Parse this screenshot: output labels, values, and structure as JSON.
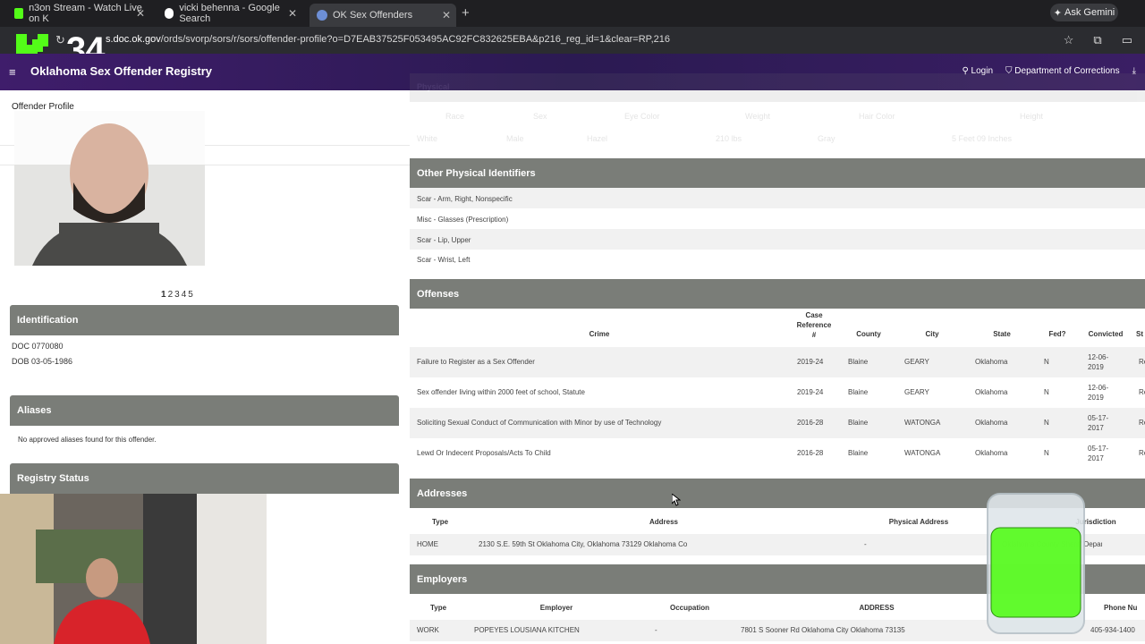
{
  "browser": {
    "tabs": [
      {
        "title": "n3on Stream - Watch Live on K",
        "active": false
      },
      {
        "title": "vicki behenna - Google Search",
        "active": false
      },
      {
        "title": "OK Sex Offenders",
        "active": true
      }
    ],
    "ask_gemini": "Ask Gemini",
    "url_domain": "s.doc.ok.gov",
    "url_path": "/ords/svorp/sors/r/sors/offender-profile?o=D7EAB37525F053495AC92FC832625EBA&p216_reg_id=1&clear=RP,216",
    "overlay_number": "34"
  },
  "site": {
    "title": "Oklahoma Sex Offender Registry",
    "login": "Login",
    "doc_link": "Department of Corrections"
  },
  "left": {
    "breadcrumb": "Offender Profile",
    "pages": [
      "1",
      "2",
      "3",
      "4",
      "5"
    ],
    "identification": {
      "heading": "Identification",
      "doc": "DOC 0770080",
      "dob": "DOB 03-05-1986"
    },
    "aliases": {
      "heading": "Aliases",
      "note": "No approved aliases found for this offender."
    },
    "registry_status": {
      "heading": "Registry Status"
    }
  },
  "right": {
    "faded": {
      "heading": "Physical",
      "cols": [
        "Race",
        "Sex",
        "Eye Color",
        "Weight",
        "Hair Color",
        "Height"
      ],
      "vals": [
        "White",
        "Male",
        "Hazel",
        "210 lbs",
        "Gray",
        "5 Feet 09 Inches"
      ]
    },
    "physical_ids": {
      "heading": "Other Physical Identifiers",
      "items": [
        "Scar - Arm, Right, Nonspecific",
        "Misc - Glasses (Prescription)",
        "Scar - Lip, Upper",
        "Scar - Wrist, Left"
      ]
    },
    "offenses": {
      "heading": "Offenses",
      "cols": {
        "crime": "Crime",
        "case1": "Case",
        "case2": "Reference",
        "case3": "#",
        "county": "County",
        "city": "City",
        "state": "State",
        "fed": "Fed?",
        "convicted": "Convicted",
        "st": "St"
      },
      "rows": [
        {
          "crime": "Failure to Register as a Sex Offender",
          "case": "2019-24",
          "county": "Blaine",
          "city": "GEARY",
          "state": "Oklahoma",
          "fed": "N",
          "conv1": "12-06-",
          "conv2": "2019",
          "st": "Re"
        },
        {
          "crime": "Sex offender living within 2000 feet of school, Statute",
          "case": "2019-24",
          "county": "Blaine",
          "city": "GEARY",
          "state": "Oklahoma",
          "fed": "N",
          "conv1": "12-06-",
          "conv2": "2019",
          "st": "Re"
        },
        {
          "crime": "Soliciting Sexual Conduct of Communication with Minor by use of Technology",
          "case": "2016-28",
          "county": "Blaine",
          "city": "WATONGA",
          "state": "Oklahoma",
          "fed": "N",
          "conv1": "05-17-",
          "conv2": "2017",
          "st": "Re"
        },
        {
          "crime": "Lewd Or Indecent Proposals/Acts To Child",
          "case": "2016-28",
          "county": "Blaine",
          "city": "WATONGA",
          "state": "Oklahoma",
          "fed": "N",
          "conv1": "05-17-",
          "conv2": "2017",
          "st": "Re"
        }
      ]
    },
    "addresses": {
      "heading": "Addresses",
      "cols": {
        "type": "Type",
        "address": "Address",
        "physical": "Physical Address",
        "jur": "Jurisdiction"
      },
      "row": {
        "type": "HOME",
        "address": "2130 S.E. 59th St Oklahoma City, Oklahoma 73129 Oklahoma Co",
        "physical": "-",
        "jur": "Oklahoma County Sheriff Department"
      }
    },
    "employers": {
      "heading": "Employers",
      "cols": {
        "type": "Type",
        "employer": "Employer",
        "occupation": "Occupation",
        "address": "ADDRESS",
        "phone": "Phone Nu"
      },
      "row": {
        "type": "WORK",
        "employer": "POPEYES LOUSIANA KITCHEN",
        "occupation": "-",
        "address": "7801 S Sooner Rd Oklahoma City Oklahoma 73135",
        "phone": "405-934-1400"
      }
    }
  },
  "colors": {
    "header_purple": "#3f1d6b",
    "section_gray": "#7a7d78",
    "kick_green": "#53fc18"
  }
}
